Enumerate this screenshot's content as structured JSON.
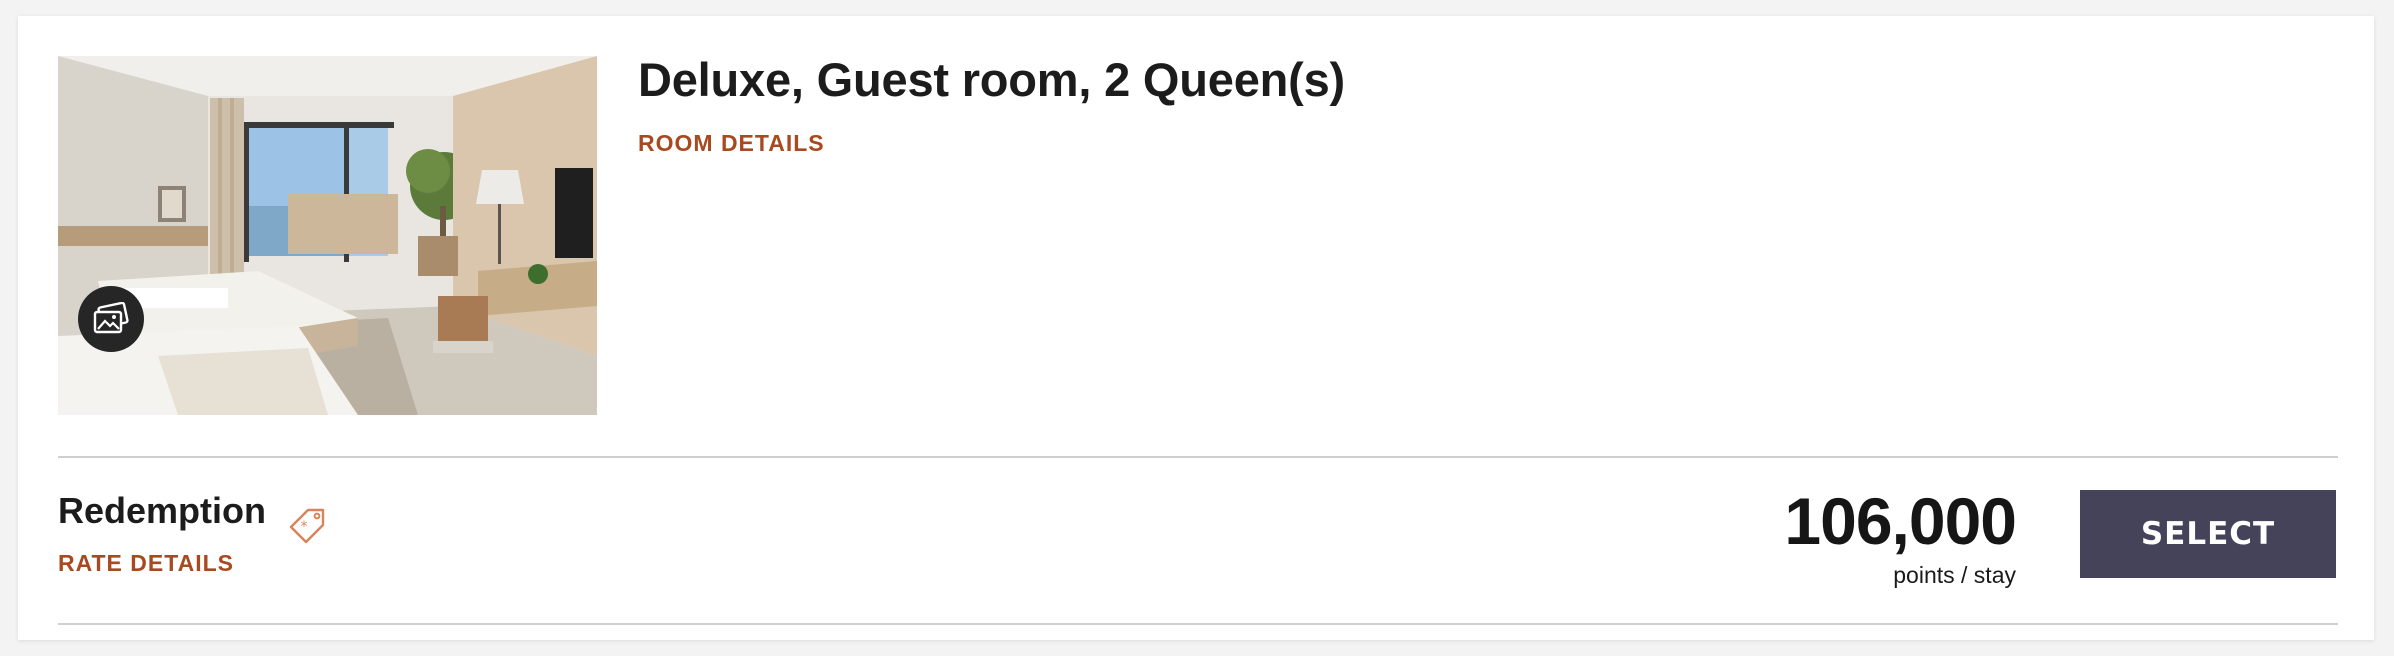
{
  "room": {
    "title": "Deluxe, Guest room, 2 Queen(s)",
    "details_link": "ROOM DETAILS",
    "photo_icon": "image-gallery-icon"
  },
  "rate": {
    "name": "Redemption",
    "tag_icon": "offer-tag-icon",
    "details_link": "RATE DETAILS",
    "price": "106,000",
    "price_unit": "points / stay",
    "select_label": "SELECT"
  },
  "colors": {
    "link_accent": "#a8491f",
    "button_bg": "#45435a",
    "divider": "#cfcfcf"
  }
}
